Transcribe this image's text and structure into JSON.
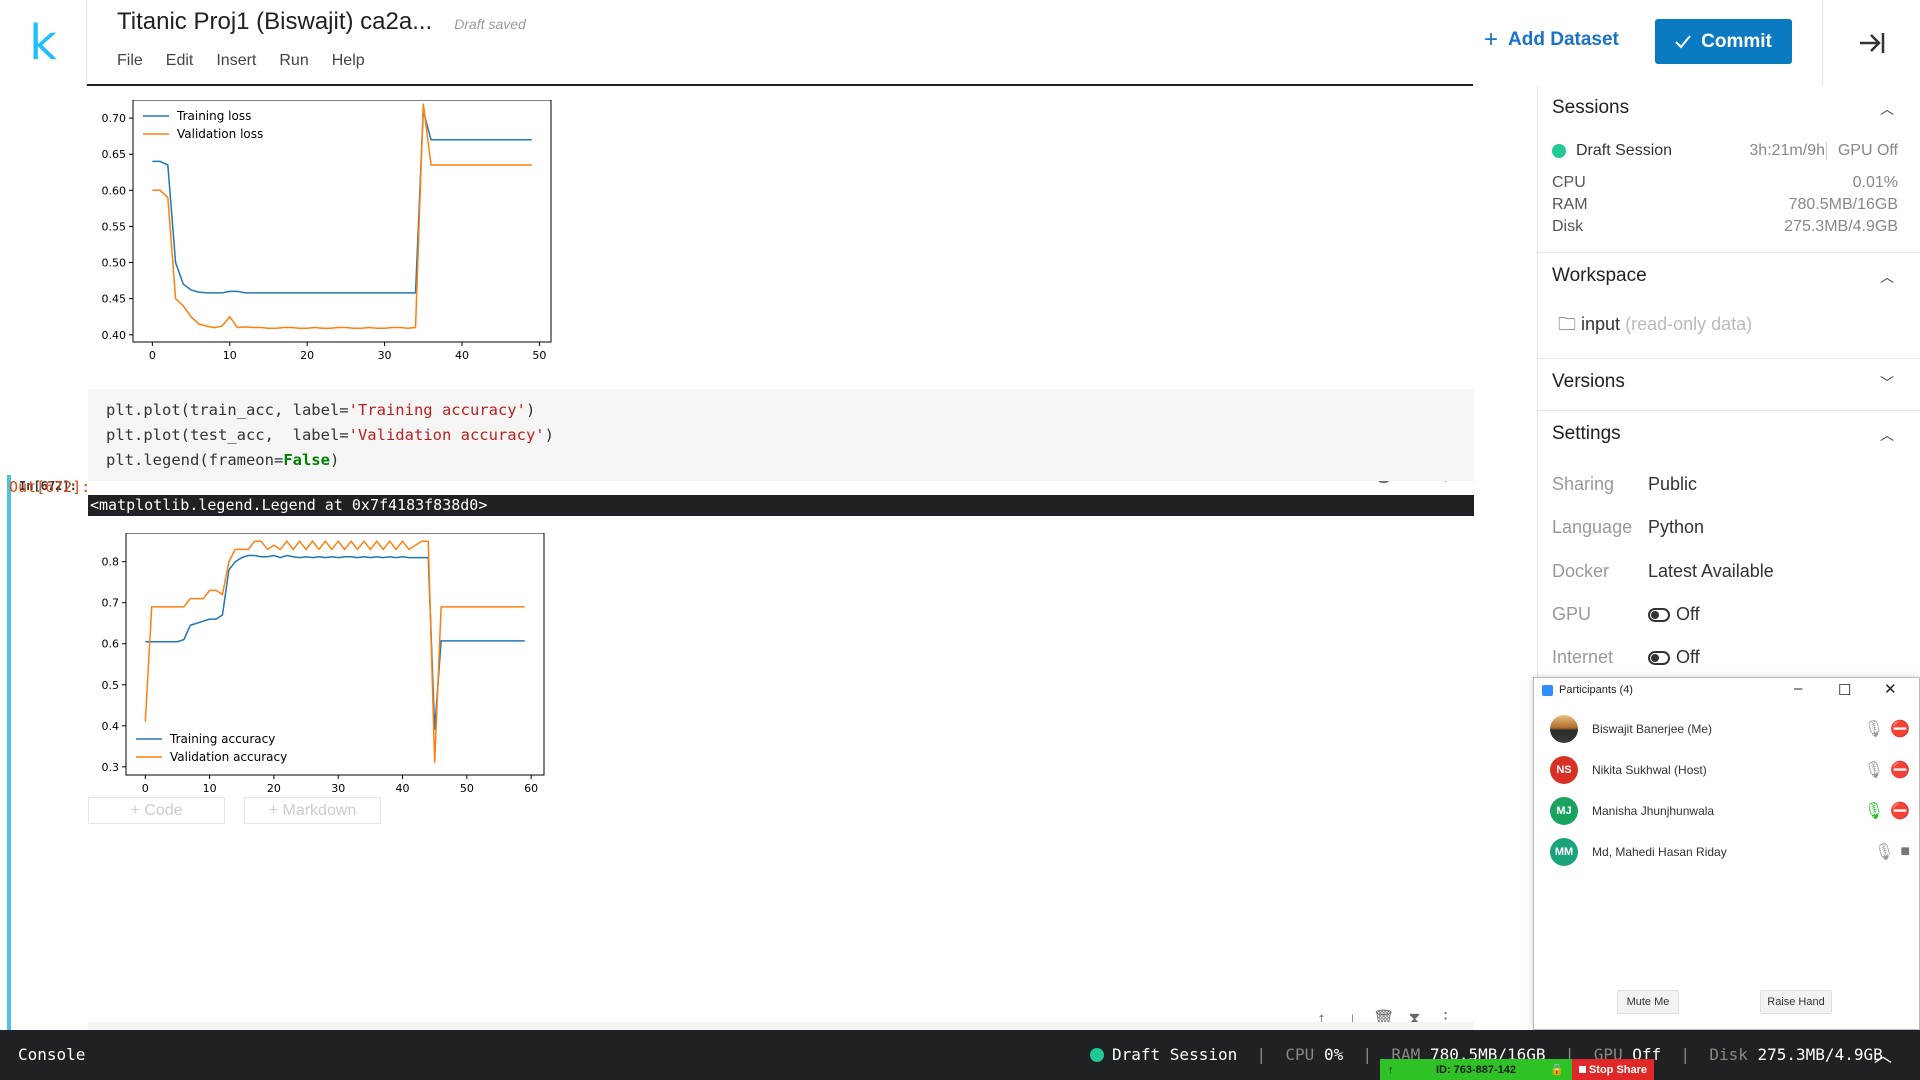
{
  "app": {
    "logo": "k",
    "title": "Titanic Proj1  (Biswajit) ca2a...",
    "draft_status": "Draft saved"
  },
  "menu": [
    "File",
    "Edit",
    "Insert",
    "Run",
    "Help"
  ],
  "toolbar": {
    "add_dataset": "Add Dataset",
    "commit": "Commit"
  },
  "cell": {
    "in_prompt": "In[672]:",
    "out_prompt": "Out[672]:",
    "code": [
      {
        "a": "plt.plot(train_acc, label=",
        "s": "'Training accuracy'",
        "b": ")"
      },
      {
        "a": "plt.plot(test_acc,  label=",
        "s": "'Validation accuracy'",
        "b": ")"
      },
      {
        "a": "plt.legend(frameon=",
        "k": "False",
        "b": ")"
      }
    ],
    "output": "<matplotlib.legend.Legend at 0x7f4183f838d0>",
    "add_code": "+ Code",
    "add_markdown": "+ Markdown"
  },
  "sidebar": {
    "sessions": {
      "title": "Sessions",
      "session_name": "Draft Session",
      "time": "3h:21m/9h",
      "gpu": "GPU Off",
      "cpu_label": "CPU",
      "cpu": "0.01%",
      "ram_label": "RAM",
      "ram": "780.5MB/16GB",
      "disk_label": "Disk",
      "disk": "275.3MB/4.9GB"
    },
    "workspace": {
      "title": "Workspace",
      "folder": "input",
      "folder_note": "(read-only data)"
    },
    "versions": {
      "title": "Versions"
    },
    "settings": {
      "title": "Settings",
      "rows": [
        {
          "label": "Sharing",
          "value": "Public"
        },
        {
          "label": "Language",
          "value": "Python"
        },
        {
          "label": "Docker",
          "value": "Latest Available"
        },
        {
          "label": "GPU",
          "value": "Off"
        },
        {
          "label": "Internet",
          "value": "Off"
        }
      ]
    }
  },
  "participants": {
    "title": "Participants (4)",
    "people": [
      {
        "initials": "",
        "name": "Biswajit Banerjee (Me)",
        "color": "#8a6d4a"
      },
      {
        "initials": "NS",
        "name": "Nikita Sukhwal (Host)",
        "color": "#d93025"
      },
      {
        "initials": "MJ",
        "name": "Manisha Jhunjhunwala",
        "color": "#1aa35f"
      },
      {
        "initials": "MM",
        "name": "Md, Mahedi Hasan Riday",
        "color": "#1aa37a"
      }
    ],
    "mute_me": "Mute Me",
    "raise_hand": "Raise Hand"
  },
  "statusbar": {
    "console": "Console",
    "session": "Draft Session",
    "cpu_label": "CPU",
    "cpu": "0%",
    "ram_label": "RAM",
    "ram": "780.5MB/16GB",
    "gpu_label": "GPU",
    "gpu": "Off",
    "disk_label": "Disk",
    "disk": "275.3MB/4.9GB"
  },
  "screen_share": {
    "id": "ID: 763-887-142",
    "stop": "Stop Share"
  },
  "chart_data": [
    {
      "type": "line",
      "xlim": [
        -2.5,
        51.5
      ],
      "ylim": [
        0.39,
        0.725
      ],
      "xticks": [
        0,
        10,
        20,
        30,
        40,
        50
      ],
      "yticks": [
        0.4,
        0.45,
        0.5,
        0.55,
        0.6,
        0.65,
        0.7
      ],
      "legend_position": "upper-left",
      "series": [
        {
          "name": "Training loss",
          "color": "#1f77b4",
          "x": [
            0,
            1,
            2,
            3,
            4,
            5,
            6,
            7,
            8,
            9,
            10,
            11,
            12,
            13,
            14,
            15,
            16,
            17,
            18,
            19,
            20,
            21,
            22,
            23,
            24,
            25,
            26,
            27,
            28,
            29,
            30,
            31,
            32,
            33,
            34,
            35,
            36,
            37,
            38,
            39,
            40,
            41,
            42,
            43,
            44,
            45,
            46,
            47,
            48,
            49
          ],
          "y": [
            0.64,
            0.64,
            0.635,
            0.5,
            0.47,
            0.462,
            0.459,
            0.458,
            0.458,
            0.458,
            0.46,
            0.46,
            0.458,
            0.458,
            0.458,
            0.458,
            0.458,
            0.458,
            0.458,
            0.458,
            0.458,
            0.458,
            0.458,
            0.458,
            0.458,
            0.458,
            0.458,
            0.458,
            0.458,
            0.458,
            0.458,
            0.458,
            0.458,
            0.458,
            0.458,
            0.71,
            0.67,
            0.67,
            0.67,
            0.67,
            0.67,
            0.67,
            0.67,
            0.67,
            0.67,
            0.67,
            0.67,
            0.67,
            0.67,
            0.67
          ]
        },
        {
          "name": "Validation loss",
          "color": "#ff7f0e",
          "x": [
            0,
            1,
            2,
            3,
            4,
            5,
            6,
            7,
            8,
            9,
            10,
            11,
            12,
            13,
            14,
            15,
            16,
            17,
            18,
            19,
            20,
            21,
            22,
            23,
            24,
            25,
            26,
            27,
            28,
            29,
            30,
            31,
            32,
            33,
            34,
            35,
            36,
            37,
            38,
            39,
            40,
            41,
            42,
            43,
            44,
            45,
            46,
            47,
            48,
            49
          ],
          "y": [
            0.6,
            0.6,
            0.59,
            0.45,
            0.44,
            0.425,
            0.415,
            0.412,
            0.41,
            0.412,
            0.425,
            0.41,
            0.411,
            0.41,
            0.41,
            0.409,
            0.409,
            0.41,
            0.41,
            0.409,
            0.409,
            0.41,
            0.409,
            0.409,
            0.41,
            0.41,
            0.409,
            0.409,
            0.41,
            0.409,
            0.409,
            0.41,
            0.41,
            0.409,
            0.41,
            0.72,
            0.635,
            0.635,
            0.635,
            0.635,
            0.635,
            0.635,
            0.635,
            0.635,
            0.635,
            0.635,
            0.635,
            0.635,
            0.635,
            0.635
          ]
        }
      ]
    },
    {
      "type": "line",
      "xlim": [
        -3,
        62
      ],
      "ylim": [
        0.28,
        0.87
      ],
      "xticks": [
        0,
        10,
        20,
        30,
        40,
        50,
        60
      ],
      "yticks": [
        0.3,
        0.4,
        0.5,
        0.6,
        0.7,
        0.8
      ],
      "legend_position": "lower-left",
      "series": [
        {
          "name": "Training accuracy",
          "color": "#1f77b4",
          "x": [
            0,
            1,
            2,
            3,
            4,
            5,
            6,
            7,
            8,
            9,
            10,
            11,
            12,
            13,
            14,
            15,
            16,
            17,
            18,
            19,
            20,
            21,
            22,
            23,
            24,
            25,
            26,
            27,
            28,
            29,
            30,
            31,
            32,
            33,
            34,
            35,
            36,
            37,
            38,
            39,
            40,
            41,
            42,
            43,
            44,
            45,
            46,
            47,
            48,
            49,
            50,
            51,
            52,
            53,
            54,
            55,
            56,
            57,
            58,
            59
          ],
          "y": [
            0.605,
            0.605,
            0.605,
            0.605,
            0.605,
            0.605,
            0.61,
            0.645,
            0.65,
            0.655,
            0.66,
            0.66,
            0.67,
            0.78,
            0.8,
            0.81,
            0.815,
            0.815,
            0.812,
            0.812,
            0.815,
            0.81,
            0.815,
            0.812,
            0.81,
            0.812,
            0.81,
            0.812,
            0.81,
            0.812,
            0.81,
            0.812,
            0.812,
            0.81,
            0.812,
            0.81,
            0.812,
            0.81,
            0.812,
            0.81,
            0.812,
            0.81,
            0.81,
            0.81,
            0.81,
            0.39,
            0.607,
            0.607,
            0.607,
            0.607,
            0.607,
            0.607,
            0.607,
            0.607,
            0.607,
            0.607,
            0.607,
            0.607,
            0.607,
            0.607
          ]
        },
        {
          "name": "Validation accuracy",
          "color": "#ff7f0e",
          "x": [
            0,
            1,
            2,
            3,
            4,
            5,
            6,
            7,
            8,
            9,
            10,
            11,
            12,
            13,
            14,
            15,
            16,
            17,
            18,
            19,
            20,
            21,
            22,
            23,
            24,
            25,
            26,
            27,
            28,
            29,
            30,
            31,
            32,
            33,
            34,
            35,
            36,
            37,
            38,
            39,
            40,
            41,
            42,
            43,
            44,
            45,
            46,
            47,
            48,
            49,
            50,
            51,
            52,
            53,
            54,
            55,
            56,
            57,
            58,
            59
          ],
          "y": [
            0.41,
            0.69,
            0.69,
            0.69,
            0.69,
            0.69,
            0.69,
            0.71,
            0.71,
            0.71,
            0.73,
            0.73,
            0.72,
            0.8,
            0.83,
            0.83,
            0.83,
            0.85,
            0.85,
            0.83,
            0.84,
            0.83,
            0.85,
            0.83,
            0.85,
            0.83,
            0.85,
            0.83,
            0.85,
            0.83,
            0.85,
            0.83,
            0.85,
            0.83,
            0.85,
            0.83,
            0.85,
            0.83,
            0.85,
            0.83,
            0.85,
            0.83,
            0.84,
            0.85,
            0.85,
            0.31,
            0.69,
            0.69,
            0.69,
            0.69,
            0.69,
            0.69,
            0.69,
            0.69,
            0.69,
            0.69,
            0.69,
            0.69,
            0.69,
            0.69
          ]
        }
      ]
    }
  ]
}
